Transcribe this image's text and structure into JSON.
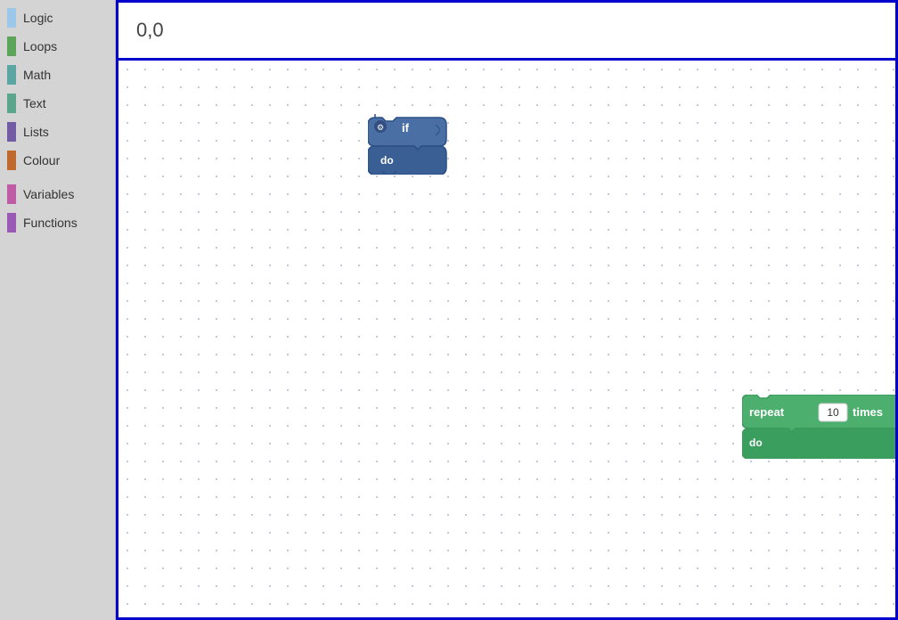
{
  "sidebar": {
    "items": [
      {
        "id": "logic",
        "label": "Logic",
        "color": "#9dc7e8"
      },
      {
        "id": "loops",
        "label": "Loops",
        "color": "#5ba55b"
      },
      {
        "id": "math",
        "label": "Math",
        "color": "#5ba5a5"
      },
      {
        "id": "text",
        "label": "Text",
        "color": "#5ba58c"
      },
      {
        "id": "lists",
        "label": "Lists",
        "color": "#745ba5"
      },
      {
        "id": "colour",
        "label": "Colour",
        "color": "#c0692c"
      },
      {
        "id": "variables",
        "label": "Variables",
        "color": "#c05ba5"
      },
      {
        "id": "functions",
        "label": "Functions",
        "color": "#9b59b6"
      }
    ]
  },
  "topbar": {
    "coordinates": "0,0"
  },
  "blocks": {
    "if_block": {
      "label_if": "if",
      "label_do": "do"
    },
    "repeat_block": {
      "label_repeat": "repeat",
      "label_times": "times",
      "label_do": "do",
      "value": "10"
    }
  }
}
